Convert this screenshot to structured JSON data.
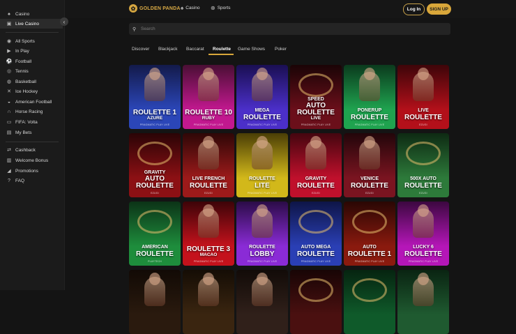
{
  "sidebar": {
    "top_items": [
      {
        "label": "Casino",
        "icon": "casino-icon",
        "glyph": "♠"
      },
      {
        "label": "Live Casino",
        "icon": "live-casino-icon",
        "glyph": "▣"
      }
    ],
    "sports_items": [
      {
        "label": "All Sports",
        "icon": "all-sports-icon",
        "glyph": "◉"
      },
      {
        "label": "In Play",
        "icon": "in-play-icon",
        "glyph": "▶"
      },
      {
        "label": "Football",
        "icon": "football-icon",
        "glyph": "⚽"
      },
      {
        "label": "Tennis",
        "icon": "tennis-icon",
        "glyph": "◎"
      },
      {
        "label": "Basketball",
        "icon": "basketball-icon",
        "glyph": "◍"
      },
      {
        "label": "Ice Hockey",
        "icon": "ice-hockey-icon",
        "glyph": "✕"
      },
      {
        "label": "American Football",
        "icon": "american-football-icon",
        "glyph": "◒"
      },
      {
        "label": "Horse Racing",
        "icon": "horse-racing-icon",
        "glyph": "∩"
      },
      {
        "label": "FIFA: Volta",
        "icon": "fifa-volta-icon",
        "glyph": "▭"
      },
      {
        "label": "My Bets",
        "icon": "my-bets-icon",
        "glyph": "▤"
      }
    ],
    "extra_items": [
      {
        "label": "Cashback",
        "icon": "cashback-icon",
        "glyph": "⇄"
      },
      {
        "label": "Welcome Bonus",
        "icon": "gift-icon",
        "glyph": "▥"
      },
      {
        "label": "Promotions",
        "icon": "megaphone-icon",
        "glyph": "◢"
      },
      {
        "label": "FAQ",
        "icon": "faq-icon",
        "glyph": "?"
      }
    ],
    "collapse_icon": "chevron-left-icon"
  },
  "header": {
    "logo_text": "GOLDEN PANDA",
    "nav": [
      {
        "label": "Casino",
        "icon": "spade-icon",
        "glyph": "♠"
      },
      {
        "label": "Sports",
        "icon": "sports-ball-icon",
        "glyph": "⊕"
      }
    ],
    "login_label": "Log In",
    "signup_label": "SIGN UP"
  },
  "search": {
    "placeholder": "Search"
  },
  "tabs": [
    {
      "label": "Discover",
      "active": false
    },
    {
      "label": "Blackjack",
      "active": false
    },
    {
      "label": "Baccarat",
      "active": false
    },
    {
      "label": "Roulette",
      "active": true
    },
    {
      "label": "Game Shows",
      "active": false
    },
    {
      "label": "Poker",
      "active": false
    }
  ],
  "games": [
    {
      "title": "ROULETTE 1",
      "sub": "AZURE",
      "provider": "PRAGMATIC PLAY LIVE",
      "bg": "#2b46b8",
      "bg2": "#131a4a",
      "kind": "dealer"
    },
    {
      "title": "ROULETTE 10",
      "sub": "RUBY",
      "provider": "PRAGMATIC PLAY LIVE",
      "bg": "#c2188f",
      "bg2": "#4a0f34",
      "kind": "dealer"
    },
    {
      "title": "MEGA",
      "sub2": "ROULETTE",
      "provider": "PRAGMATIC PLAY LIVE",
      "bg": "#4b2fc9",
      "bg2": "#1a0f52",
      "kind": "dealer"
    },
    {
      "title": "SPEED",
      "sub2": "AUTO ROULETTE",
      "sub": "LIVE",
      "provider": "PRAGMATIC PLAY LIVE",
      "bg": "#6b0f1a",
      "bg2": "#1a0406",
      "kind": "wheel"
    },
    {
      "title": "PONERUP",
      "sub2": "ROULETTE",
      "provider": "PRAGMATIC PLAY LIVE",
      "bg": "#1fa34f",
      "bg2": "#0b3a1d",
      "kind": "dealer"
    },
    {
      "title": "LIVE",
      "sub2": "ROULETTE",
      "provider": "EZUGI",
      "bg": "#b3101a",
      "bg2": "#3d0509",
      "kind": "dealer"
    },
    {
      "title": "GRAVITY",
      "sub2": "AUTO ROULETTE",
      "provider": "EZUGI",
      "bg": "#8c1014",
      "bg2": "#2a0406",
      "kind": "wheel"
    },
    {
      "title": "LIVE FRENCH",
      "sub2": "ROULETTE",
      "provider": "EZUGI",
      "bg": "#9c1a1a",
      "bg2": "#2e0707",
      "kind": "dealer"
    },
    {
      "title": "ROULETTE",
      "sub2": "LITE",
      "provider": "PRAGMATIC PLAY LIVE",
      "bg": "#d2b81a",
      "bg2": "#4a3d06",
      "kind": "dealer"
    },
    {
      "title": "GRAVITY",
      "sub2": "ROULETTE",
      "provider": "EZUGI",
      "bg": "#c0102c",
      "bg2": "#44060f",
      "kind": "dealer"
    },
    {
      "title": "VENICE",
      "sub2": "ROULETTE",
      "provider": "EZUGI",
      "bg": "#7a1420",
      "bg2": "#22060a",
      "kind": "dealer"
    },
    {
      "title": "500X AUTO",
      "sub2": "ROULETTE",
      "provider": "EZUGI",
      "bg": "#2d7a3a",
      "bg2": "#0e2a13",
      "kind": "wheel"
    },
    {
      "title": "AMERICAN",
      "sub2": "ROULETTE",
      "provider": "PLAYTECH",
      "bg": "#1e8d3c",
      "bg2": "#0c3317",
      "kind": "wheel"
    },
    {
      "title": "ROULETTE 3",
      "sub": "MACAO",
      "provider": "PRAGMATIC PLAY LIVE",
      "bg": "#c4121c",
      "bg2": "#3d0408",
      "kind": "dealer"
    },
    {
      "title": "ROULETTE",
      "sub2": "LOBBY",
      "provider": "PRAGMATIC PLAY LIVE",
      "bg": "#8a2bd6",
      "bg2": "#2b0c47",
      "kind": "dealer"
    },
    {
      "title": "AUTO MEGA",
      "sub2": "ROULETTE",
      "provider": "PRAGMATIC PLAY LIVE",
      "bg": "#2a3fb5",
      "bg2": "#0e1547",
      "kind": "wheel"
    },
    {
      "title": "AUTO",
      "sub2": "ROULETTE 1",
      "provider": "PRAGMATIC PLAY LIVE",
      "bg": "#8a1a0e",
      "bg2": "#2a0704",
      "kind": "wheel"
    },
    {
      "title": "LUCKY 6",
      "sub2": "ROULETTE",
      "provider": "PRAGMATIC PLAY LIVE",
      "bg": "#b516b8",
      "bg2": "#3c0840",
      "kind": "dealer"
    },
    {
      "title": "",
      "provider": "",
      "bg": "#2a1a0e",
      "bg2": "#120a05",
      "kind": "dealer"
    },
    {
      "title": "",
      "provider": "",
      "bg": "#3a2510",
      "bg2": "#150d05",
      "kind": "dealer"
    },
    {
      "title": "",
      "provider": "",
      "bg": "#30201a",
      "bg2": "#120b08",
      "kind": "dealer"
    },
    {
      "title": "",
      "provider": "",
      "bg": "#4a1010",
      "bg2": "#180505",
      "kind": "wheel"
    },
    {
      "title": "",
      "provider": "",
      "bg": "#0f5a2a",
      "bg2": "#062410",
      "kind": "wheel"
    },
    {
      "title": "",
      "provider": "",
      "bg": "#1f5a30",
      "bg2": "#0a2412",
      "kind": "dealer"
    }
  ]
}
